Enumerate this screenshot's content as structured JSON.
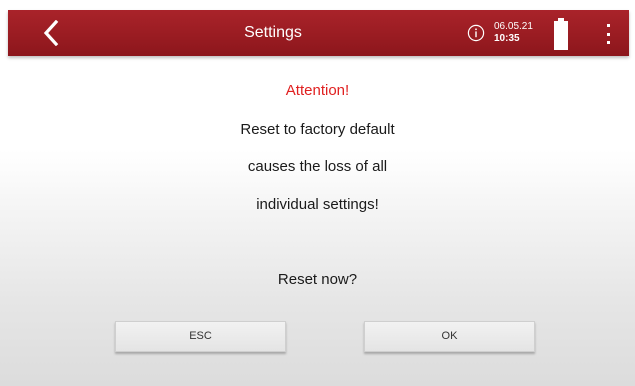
{
  "header": {
    "title": "Settings",
    "date": "06.05.21",
    "time": "10:35",
    "accent_color": "#9a1c22",
    "icons": {
      "back": "chevron-left-icon",
      "info": "info-icon",
      "battery": "battery-icon",
      "menu": "more-vertical-icon"
    }
  },
  "dialog": {
    "attention": "Attention!",
    "line1": "Reset to factory default",
    "line2": "causes the loss of all",
    "line3": "individual settings!",
    "question": "Reset now?",
    "attention_color": "#e02020"
  },
  "buttons": {
    "esc": "ESC",
    "ok": "OK"
  }
}
